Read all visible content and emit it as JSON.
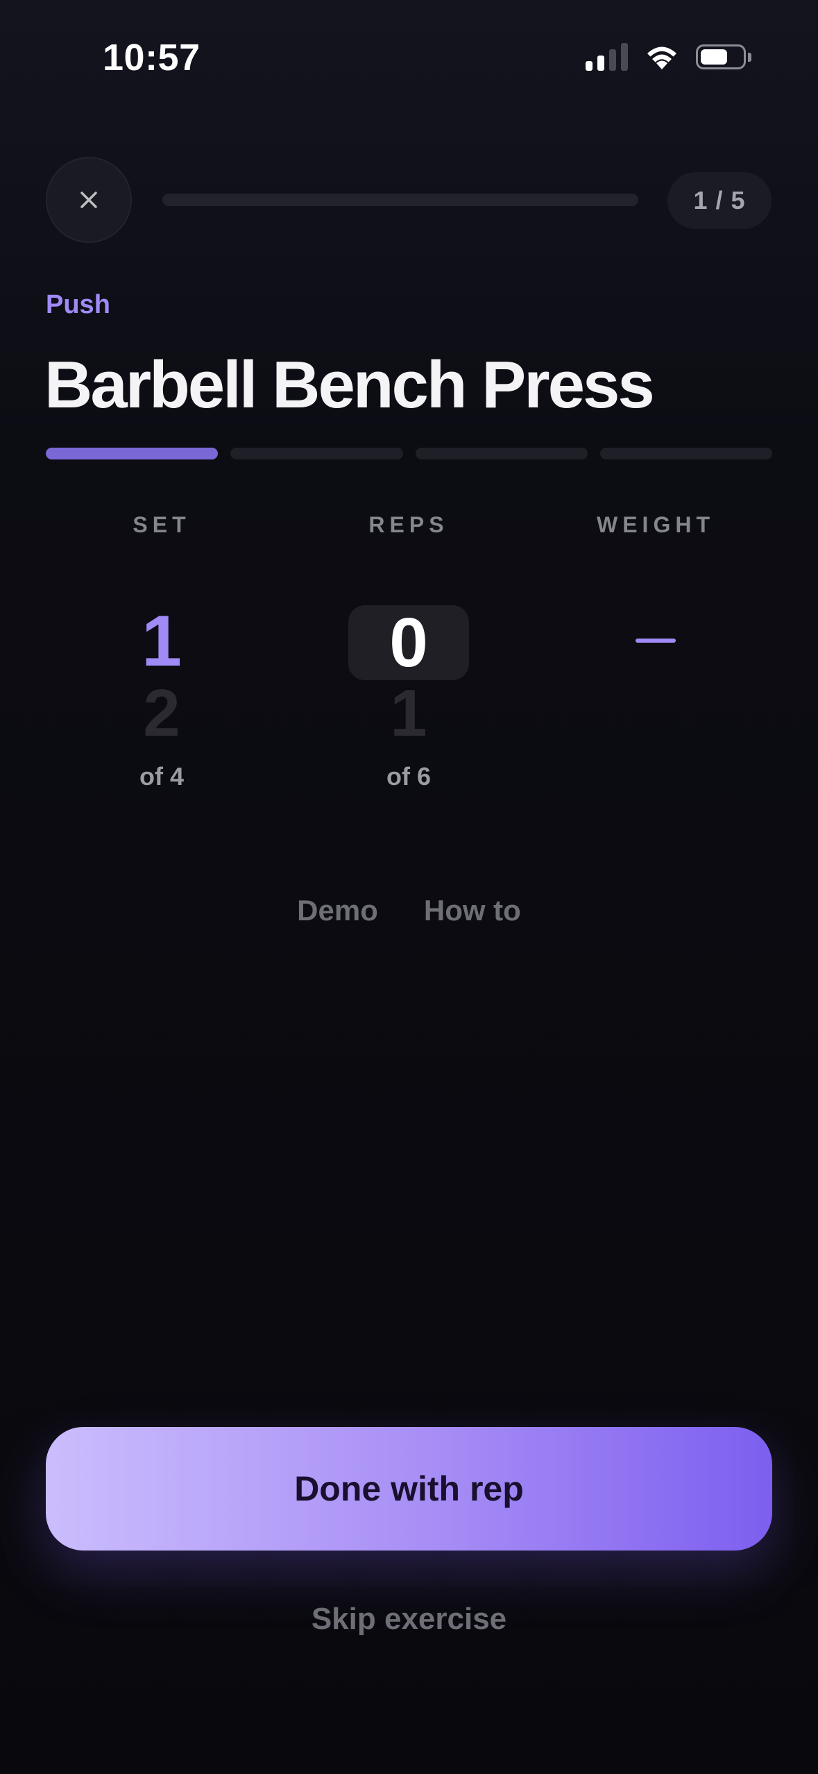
{
  "status_bar": {
    "time": "10:57",
    "icons": [
      "cellular-signal-icon",
      "wifi-icon",
      "battery-icon"
    ]
  },
  "header": {
    "close_icon": "close-icon",
    "workout_progress": 0,
    "counter": "1 / 5"
  },
  "exercise": {
    "category": "Push",
    "title": "Barbell Bench Press",
    "total_sets": 4,
    "completed_segments": 1
  },
  "columns": {
    "set": {
      "label": "SET",
      "current": "1",
      "next": "2",
      "of": "of 4"
    },
    "reps": {
      "label": "REPS",
      "current": "0",
      "next": "1",
      "of": "of 6"
    },
    "weight": {
      "label": "WEIGHT",
      "value": "—"
    }
  },
  "links": {
    "demo": "Demo",
    "how_to": "How to"
  },
  "actions": {
    "done": "Done with rep",
    "skip": "Skip exercise"
  },
  "colors": {
    "accent": "#a08af5",
    "background": "#0a0a0f",
    "button_gradient_start": "#cbbdfd",
    "button_gradient_end": "#7d5ff0"
  }
}
